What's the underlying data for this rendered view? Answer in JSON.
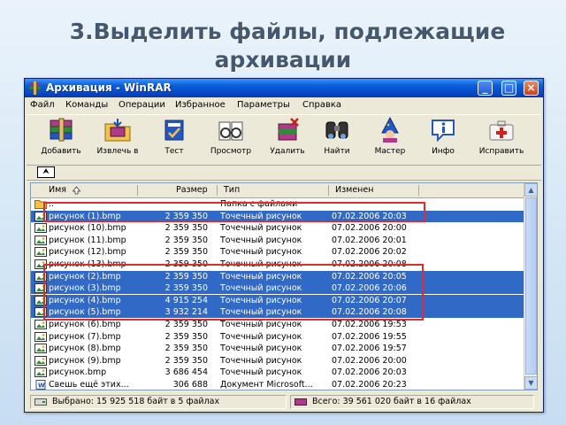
{
  "slide": {
    "title_line1": "3.Выделить файлы,  подлежащие",
    "title_line2": "архивации"
  },
  "window": {
    "title": "Архивация - WinRAR",
    "controls": {
      "minimize": "_",
      "maximize": "□",
      "close": "×"
    }
  },
  "menu": [
    "Файл",
    "Команды",
    "Операции",
    "Избранное",
    "Параметры",
    "Справка"
  ],
  "toolbar": [
    {
      "label": "Добавить",
      "icon": "add-archive-icon"
    },
    {
      "label": "Извлечь в",
      "icon": "extract-folder-icon"
    },
    {
      "label": "Тест",
      "icon": "test-book-icon"
    },
    {
      "label": "Просмотр",
      "icon": "view-glasses-icon"
    },
    {
      "label": "Удалить",
      "icon": "delete-icon"
    },
    {
      "label": "Найти",
      "icon": "find-binoculars-icon"
    },
    {
      "label": "Мастер",
      "icon": "wizard-icon"
    },
    {
      "label": "Инфо",
      "icon": "info-icon"
    },
    {
      "label": "Исправить",
      "icon": "repair-kit-icon"
    }
  ],
  "pathbar": {
    "up_glyph": "⮝"
  },
  "columns": {
    "name": "Имя",
    "size": "Размер",
    "type": "Тип",
    "modified": "Изменен"
  },
  "files": [
    {
      "name": "..",
      "size": "",
      "type": "Папка с файлами",
      "date": "",
      "selected": false,
      "kind": "folder"
    },
    {
      "name": "рисунок (1).bmp",
      "size": "2 359 350",
      "type": "Точечный рисунок",
      "date": "07.02.2006 20:03",
      "selected": true,
      "kind": "bmp"
    },
    {
      "name": "рисунок (10).bmp",
      "size": "2 359 350",
      "type": "Точечный рисунок",
      "date": "07.02.2006 20:00",
      "selected": false,
      "kind": "bmp"
    },
    {
      "name": "рисунок (11).bmp",
      "size": "2 359 350",
      "type": "Точечный рисунок",
      "date": "07.02.2006 20:01",
      "selected": false,
      "kind": "bmp"
    },
    {
      "name": "рисунок (12).bmp",
      "size": "2 359 350",
      "type": "Точечный рисунок",
      "date": "07.02.2006 20:02",
      "selected": false,
      "kind": "bmp"
    },
    {
      "name": "рисунок (13).bmp",
      "size": "2 359 350",
      "type": "Точечный рисунок",
      "date": "07.02.2006 20:08",
      "selected": false,
      "kind": "bmp"
    },
    {
      "name": "рисунок (2).bmp",
      "size": "2 359 350",
      "type": "Точечный рисунок",
      "date": "07.02.2006 20:05",
      "selected": true,
      "kind": "bmp"
    },
    {
      "name": "рисунок (3).bmp",
      "size": "2 359 350",
      "type": "Точечный рисунок",
      "date": "07.02.2006 20:06",
      "selected": true,
      "kind": "bmp"
    },
    {
      "name": "рисунок (4).bmp",
      "size": "4 915 254",
      "type": "Точечный рисунок",
      "date": "07.02.2006 20:07",
      "selected": true,
      "kind": "bmp"
    },
    {
      "name": "рисунок (5).bmp",
      "size": "3 932 214",
      "type": "Точечный рисунок",
      "date": "07.02.2006 20:08",
      "selected": true,
      "kind": "bmp"
    },
    {
      "name": "рисунок (6).bmp",
      "size": "2 359 350",
      "type": "Точечный рисунок",
      "date": "07.02.2006 19:53",
      "selected": false,
      "kind": "bmp"
    },
    {
      "name": "рисунок (7).bmp",
      "size": "2 359 350",
      "type": "Точечный рисунок",
      "date": "07.02.2006 19:55",
      "selected": false,
      "kind": "bmp"
    },
    {
      "name": "рисунок (8).bmp",
      "size": "2 359 350",
      "type": "Точечный рисунок",
      "date": "07.02.2006 19:57",
      "selected": false,
      "kind": "bmp"
    },
    {
      "name": "рисунок (9).bmp",
      "size": "2 359 350",
      "type": "Точечный рисунок",
      "date": "07.02.2006 20:00",
      "selected": false,
      "kind": "bmp"
    },
    {
      "name": "рисунок.bmp",
      "size": "3 686 454",
      "type": "Точечный рисунок",
      "date": "07.02.2006 20:03",
      "selected": false,
      "kind": "bmp"
    },
    {
      "name": "Свешь ещё этих...",
      "size": "306 688",
      "type": "Документ Microsoft...",
      "date": "07.02.2006 20:23",
      "selected": false,
      "kind": "doc"
    }
  ],
  "status": {
    "selected": "Выбрано: 15 925 518 байт в 5 файлах",
    "total": "Всего: 39 561 020 байт в 16 файлах"
  },
  "colors": {
    "title_text": "#44596f",
    "selection": "#3169c6",
    "highlight_frame": "#e22c2c",
    "titlebar": "#0a5fd8"
  }
}
